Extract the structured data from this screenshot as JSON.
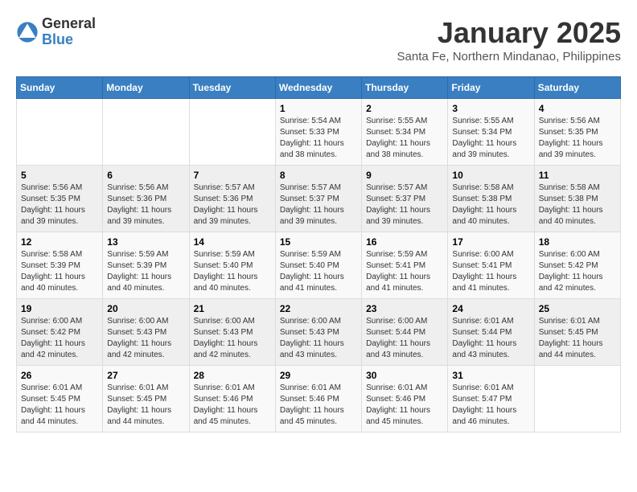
{
  "logo": {
    "general": "General",
    "blue": "Blue"
  },
  "title": "January 2025",
  "subtitle": "Santa Fe, Northern Mindanao, Philippines",
  "days_of_week": [
    "Sunday",
    "Monday",
    "Tuesday",
    "Wednesday",
    "Thursday",
    "Friday",
    "Saturday"
  ],
  "weeks": [
    [
      {
        "day": "",
        "sunrise": "",
        "sunset": "",
        "daylight": ""
      },
      {
        "day": "",
        "sunrise": "",
        "sunset": "",
        "daylight": ""
      },
      {
        "day": "",
        "sunrise": "",
        "sunset": "",
        "daylight": ""
      },
      {
        "day": "1",
        "sunrise": "Sunrise: 5:54 AM",
        "sunset": "Sunset: 5:33 PM",
        "daylight": "Daylight: 11 hours and 38 minutes."
      },
      {
        "day": "2",
        "sunrise": "Sunrise: 5:55 AM",
        "sunset": "Sunset: 5:34 PM",
        "daylight": "Daylight: 11 hours and 38 minutes."
      },
      {
        "day": "3",
        "sunrise": "Sunrise: 5:55 AM",
        "sunset": "Sunset: 5:34 PM",
        "daylight": "Daylight: 11 hours and 39 minutes."
      },
      {
        "day": "4",
        "sunrise": "Sunrise: 5:56 AM",
        "sunset": "Sunset: 5:35 PM",
        "daylight": "Daylight: 11 hours and 39 minutes."
      }
    ],
    [
      {
        "day": "5",
        "sunrise": "Sunrise: 5:56 AM",
        "sunset": "Sunset: 5:35 PM",
        "daylight": "Daylight: 11 hours and 39 minutes."
      },
      {
        "day": "6",
        "sunrise": "Sunrise: 5:56 AM",
        "sunset": "Sunset: 5:36 PM",
        "daylight": "Daylight: 11 hours and 39 minutes."
      },
      {
        "day": "7",
        "sunrise": "Sunrise: 5:57 AM",
        "sunset": "Sunset: 5:36 PM",
        "daylight": "Daylight: 11 hours and 39 minutes."
      },
      {
        "day": "8",
        "sunrise": "Sunrise: 5:57 AM",
        "sunset": "Sunset: 5:37 PM",
        "daylight": "Daylight: 11 hours and 39 minutes."
      },
      {
        "day": "9",
        "sunrise": "Sunrise: 5:57 AM",
        "sunset": "Sunset: 5:37 PM",
        "daylight": "Daylight: 11 hours and 39 minutes."
      },
      {
        "day": "10",
        "sunrise": "Sunrise: 5:58 AM",
        "sunset": "Sunset: 5:38 PM",
        "daylight": "Daylight: 11 hours and 40 minutes."
      },
      {
        "day": "11",
        "sunrise": "Sunrise: 5:58 AM",
        "sunset": "Sunset: 5:38 PM",
        "daylight": "Daylight: 11 hours and 40 minutes."
      }
    ],
    [
      {
        "day": "12",
        "sunrise": "Sunrise: 5:58 AM",
        "sunset": "Sunset: 5:39 PM",
        "daylight": "Daylight: 11 hours and 40 minutes."
      },
      {
        "day": "13",
        "sunrise": "Sunrise: 5:59 AM",
        "sunset": "Sunset: 5:39 PM",
        "daylight": "Daylight: 11 hours and 40 minutes."
      },
      {
        "day": "14",
        "sunrise": "Sunrise: 5:59 AM",
        "sunset": "Sunset: 5:40 PM",
        "daylight": "Daylight: 11 hours and 40 minutes."
      },
      {
        "day": "15",
        "sunrise": "Sunrise: 5:59 AM",
        "sunset": "Sunset: 5:40 PM",
        "daylight": "Daylight: 11 hours and 41 minutes."
      },
      {
        "day": "16",
        "sunrise": "Sunrise: 5:59 AM",
        "sunset": "Sunset: 5:41 PM",
        "daylight": "Daylight: 11 hours and 41 minutes."
      },
      {
        "day": "17",
        "sunrise": "Sunrise: 6:00 AM",
        "sunset": "Sunset: 5:41 PM",
        "daylight": "Daylight: 11 hours and 41 minutes."
      },
      {
        "day": "18",
        "sunrise": "Sunrise: 6:00 AM",
        "sunset": "Sunset: 5:42 PM",
        "daylight": "Daylight: 11 hours and 42 minutes."
      }
    ],
    [
      {
        "day": "19",
        "sunrise": "Sunrise: 6:00 AM",
        "sunset": "Sunset: 5:42 PM",
        "daylight": "Daylight: 11 hours and 42 minutes."
      },
      {
        "day": "20",
        "sunrise": "Sunrise: 6:00 AM",
        "sunset": "Sunset: 5:43 PM",
        "daylight": "Daylight: 11 hours and 42 minutes."
      },
      {
        "day": "21",
        "sunrise": "Sunrise: 6:00 AM",
        "sunset": "Sunset: 5:43 PM",
        "daylight": "Daylight: 11 hours and 42 minutes."
      },
      {
        "day": "22",
        "sunrise": "Sunrise: 6:00 AM",
        "sunset": "Sunset: 5:43 PM",
        "daylight": "Daylight: 11 hours and 43 minutes."
      },
      {
        "day": "23",
        "sunrise": "Sunrise: 6:00 AM",
        "sunset": "Sunset: 5:44 PM",
        "daylight": "Daylight: 11 hours and 43 minutes."
      },
      {
        "day": "24",
        "sunrise": "Sunrise: 6:01 AM",
        "sunset": "Sunset: 5:44 PM",
        "daylight": "Daylight: 11 hours and 43 minutes."
      },
      {
        "day": "25",
        "sunrise": "Sunrise: 6:01 AM",
        "sunset": "Sunset: 5:45 PM",
        "daylight": "Daylight: 11 hours and 44 minutes."
      }
    ],
    [
      {
        "day": "26",
        "sunrise": "Sunrise: 6:01 AM",
        "sunset": "Sunset: 5:45 PM",
        "daylight": "Daylight: 11 hours and 44 minutes."
      },
      {
        "day": "27",
        "sunrise": "Sunrise: 6:01 AM",
        "sunset": "Sunset: 5:45 PM",
        "daylight": "Daylight: 11 hours and 44 minutes."
      },
      {
        "day": "28",
        "sunrise": "Sunrise: 6:01 AM",
        "sunset": "Sunset: 5:46 PM",
        "daylight": "Daylight: 11 hours and 45 minutes."
      },
      {
        "day": "29",
        "sunrise": "Sunrise: 6:01 AM",
        "sunset": "Sunset: 5:46 PM",
        "daylight": "Daylight: 11 hours and 45 minutes."
      },
      {
        "day": "30",
        "sunrise": "Sunrise: 6:01 AM",
        "sunset": "Sunset: 5:46 PM",
        "daylight": "Daylight: 11 hours and 45 minutes."
      },
      {
        "day": "31",
        "sunrise": "Sunrise: 6:01 AM",
        "sunset": "Sunset: 5:47 PM",
        "daylight": "Daylight: 11 hours and 46 minutes."
      },
      {
        "day": "",
        "sunrise": "",
        "sunset": "",
        "daylight": ""
      }
    ]
  ]
}
